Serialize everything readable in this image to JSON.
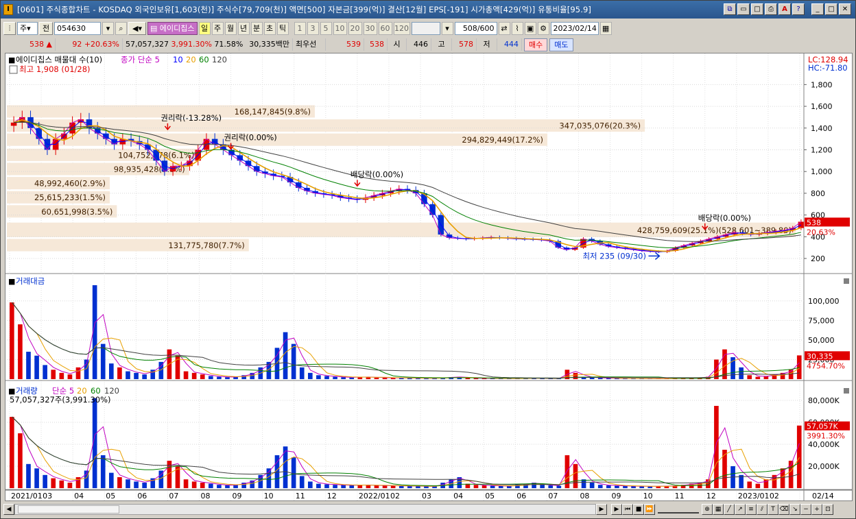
{
  "window": {
    "title": "[0601] 주식종합차트 - KOSDAQ 외국인보유[1,603(천)] 주식수[79,709(천)] 액면[500] 자본금[399(억)] 결산[12월] EPS[-191] 시가총액[429(억)] 유통비율[95.9]",
    "app_icon": "chart-app-icon"
  },
  "toolbar": {
    "period_select": "주",
    "prev_label": "전",
    "code_value": "054630",
    "stock_name": "에이디칩스",
    "period_buttons": [
      "일",
      "주",
      "월",
      "년",
      "분",
      "초",
      "틱"
    ],
    "interval_buttons": [
      "1",
      "3",
      "5",
      "10",
      "20",
      "30",
      "60",
      "120"
    ],
    "count_value": "508",
    "count_total": "/600",
    "date_value": "2023/02/14"
  },
  "quote": {
    "price": "538",
    "change_arrow": "▲",
    "change": "92",
    "change_pct": "+20.63%",
    "volume": "57,057,327",
    "volume_ratio": "3,991.30%",
    "turnover_pct": "71.58%",
    "amount": "30,335백만",
    "best_quote_label": "최우선",
    "ask": "539",
    "bid": "538",
    "open_label": "시",
    "open": "446",
    "high_label": "고",
    "high": "578",
    "low_label": "저",
    "low": "444",
    "buy_label": "매수",
    "sell_label": "매도"
  },
  "colors": {
    "up": "#e00000",
    "down": "#0030d0",
    "ma5": "#c000c0",
    "ma10": "#0000ff",
    "ma20": "#e8a000",
    "ma60": "#008000",
    "ma120": "#404040",
    "band": "#f6e8d8"
  },
  "chart_data": [
    {
      "type": "candlestick",
      "panel": "price",
      "legend_title": "에이디칩스 매물대 수(10)",
      "legend_ma_label": "종가 단순 5",
      "legend_ma_periods": [
        "10",
        "20",
        "60",
        "120"
      ],
      "max_label": "최고 1,908 (01/28)",
      "min_label": "최저 235 (09/30)",
      "lc_label": "LC:128.94",
      "hc_label": "HC:-71.80",
      "last_price_tag": "538",
      "last_pct_tag": "20.63%",
      "y_ticks": [
        "1,800",
        "1,600",
        "1,400",
        "1,200",
        "1,000",
        "800",
        "600",
        "400",
        "200"
      ],
      "y_tick_values": [
        1800,
        1600,
        1400,
        1200,
        1000,
        800,
        600,
        400,
        200
      ],
      "ylim": [
        80,
        1960
      ],
      "x_labels": [
        "2021/01",
        "03",
        "04",
        "05",
        "06",
        "07",
        "08",
        "09",
        "10",
        "11",
        "12",
        "2022/01",
        "02",
        "03",
        "04",
        "05",
        "06",
        "07",
        "08",
        "09",
        "10",
        "11",
        "12",
        "2023/01",
        "02",
        "02/14"
      ],
      "events": [
        {
          "label": "권리락(-13.28%)",
          "x": "2021/06",
          "y": 1380
        },
        {
          "label": "권리락(0.00%)",
          "x": "2021/08",
          "y": 1200
        },
        {
          "label": "배당락(0.00%)",
          "x": "2021/12",
          "y": 860
        },
        {
          "label": "배당락(0.00%)",
          "x": "2022/12",
          "y": 460
        }
      ],
      "volume_profile": [
        {
          "label": "168,147,845(9.8%)",
          "price_low": 1490,
          "price_high": 1610
        },
        {
          "label": "347,035,076(20.3%)",
          "price_low": 1360,
          "price_high": 1480
        },
        {
          "label": "294,829,449(17.2%)",
          "price_low": 1230,
          "price_high": 1350
        },
        {
          "label": "104,752,778(6.1%)",
          "price_low": 1090,
          "price_high": 1210
        },
        {
          "label": "98,935,428(5.8%)",
          "price_low": 960,
          "price_high": 1080
        },
        {
          "label": "48,992,460(2.9%)",
          "price_low": 830,
          "price_high": 950
        },
        {
          "label": "25,615,233(1.5%)",
          "price_low": 700,
          "price_high": 820
        },
        {
          "label": "60,651,998(3.5%)",
          "price_low": 570,
          "price_high": 690
        },
        {
          "label": "428,759,609(25.1%)(528,601~389.80)",
          "price_low": 390,
          "price_high": 530
        },
        {
          "label": "131,775,780(7.7%)",
          "price_low": 260,
          "price_high": 380
        }
      ],
      "close_trend": [
        1450,
        1500,
        1400,
        1300,
        1200,
        1300,
        1350,
        1450,
        1480,
        1400,
        1350,
        1300,
        1250,
        1300,
        1280,
        1250,
        1200,
        1100,
        1000,
        1050,
        1050,
        1100,
        1200,
        1300,
        1250,
        1200,
        1150,
        1100,
        1050,
        1000,
        980,
        960,
        950,
        900,
        850,
        820,
        800,
        790,
        780,
        760,
        750,
        740,
        760,
        780,
        800,
        820,
        840,
        830,
        800,
        700,
        600,
        420,
        390,
        385,
        380,
        385,
        390,
        395,
        390,
        385,
        380,
        378,
        376,
        370,
        360,
        300,
        280,
        300,
        380,
        360,
        330,
        310,
        300,
        290,
        280,
        270,
        265,
        260,
        270,
        300,
        320,
        340,
        360,
        380,
        400,
        420,
        440,
        430,
        420,
        430,
        440,
        450,
        460,
        480,
        538
      ]
    },
    {
      "type": "bar",
      "panel": "trading-value",
      "legend_title": "거래대금",
      "y_ticks": [
        "100,000",
        "75,000",
        "50,000",
        "25,000"
      ],
      "y_tick_values": [
        100000,
        75000,
        50000,
        25000
      ],
      "ylim": [
        0,
        120000
      ],
      "last_value_tag": "30,335",
      "last_pct_tag": "4754.70%",
      "values": [
        98000,
        70000,
        35000,
        30000,
        18000,
        12000,
        8000,
        6000,
        15000,
        25000,
        120000,
        45000,
        20000,
        15000,
        10000,
        8000,
        6000,
        12000,
        22000,
        38000,
        30000,
        10000,
        8000,
        6000,
        4000,
        3000,
        2500,
        3000,
        5000,
        8000,
        15000,
        22000,
        40000,
        60000,
        45000,
        15000,
        8000,
        5000,
        4000,
        3000,
        2500,
        2000,
        3000,
        2500,
        2000,
        1800,
        1600,
        1500,
        1400,
        1300,
        1200,
        1000,
        1800,
        2500,
        3000,
        1500,
        1200,
        1000,
        900,
        800,
        700,
        900,
        1200,
        1500,
        1000,
        800,
        700,
        12000,
        8000,
        3000,
        2000,
        1500,
        1200,
        1000,
        900,
        800,
        700,
        600,
        700,
        800,
        900,
        1200,
        1500,
        2000,
        3000,
        25000,
        38000,
        28000,
        15000,
        5000,
        3000,
        4000,
        6000,
        8000,
        12000,
        30335
      ]
    },
    {
      "type": "bar",
      "panel": "volume",
      "legend_title": "거래량",
      "legend_ma_label": "단순 5",
      "legend_ma_periods": [
        "20",
        "60",
        "120"
      ],
      "info_label": "57,057,327주(3,991.30%)",
      "y_ticks": [
        "80,000K",
        "60,000K",
        "40,000K",
        "20,000K"
      ],
      "y_tick_values": [
        80000,
        60000,
        40000,
        20000
      ],
      "ylim": [
        0,
        85000
      ],
      "last_value_tag": "57,057K",
      "last_pct_tag": "3991.30%",
      "values": [
        65000,
        50000,
        22000,
        18000,
        12000,
        9000,
        7000,
        5000,
        10000,
        16000,
        82000,
        30000,
        14000,
        10000,
        8000,
        6000,
        5000,
        9000,
        16000,
        25000,
        20000,
        8000,
        6000,
        5000,
        4000,
        3000,
        2500,
        3000,
        5000,
        7000,
        12000,
        18000,
        30000,
        38000,
        28000,
        11000,
        6000,
        4000,
        3500,
        3000,
        2800,
        2500,
        3000,
        2800,
        2500,
        2300,
        2200,
        2000,
        1900,
        1800,
        1700,
        1600,
        5000,
        8000,
        10000,
        4000,
        3000,
        2500,
        2200,
        2000,
        1800,
        3000,
        4000,
        5000,
        3000,
        2500,
        2200,
        30000,
        22000,
        8000,
        5000,
        3000,
        2500,
        2200,
        2000,
        1800,
        1700,
        1600,
        1800,
        2000,
        2200,
        3000,
        4000,
        5000,
        8000,
        75000,
        35000,
        20000,
        12000,
        6000,
        4000,
        8000,
        12000,
        18000,
        25000,
        57057
      ]
    }
  ],
  "scroll_icons": [
    "play-icon",
    "step-back-icon",
    "stop-icon",
    "fast-forward-icon",
    "zoom-out-icon",
    "zoom-in-icon"
  ]
}
